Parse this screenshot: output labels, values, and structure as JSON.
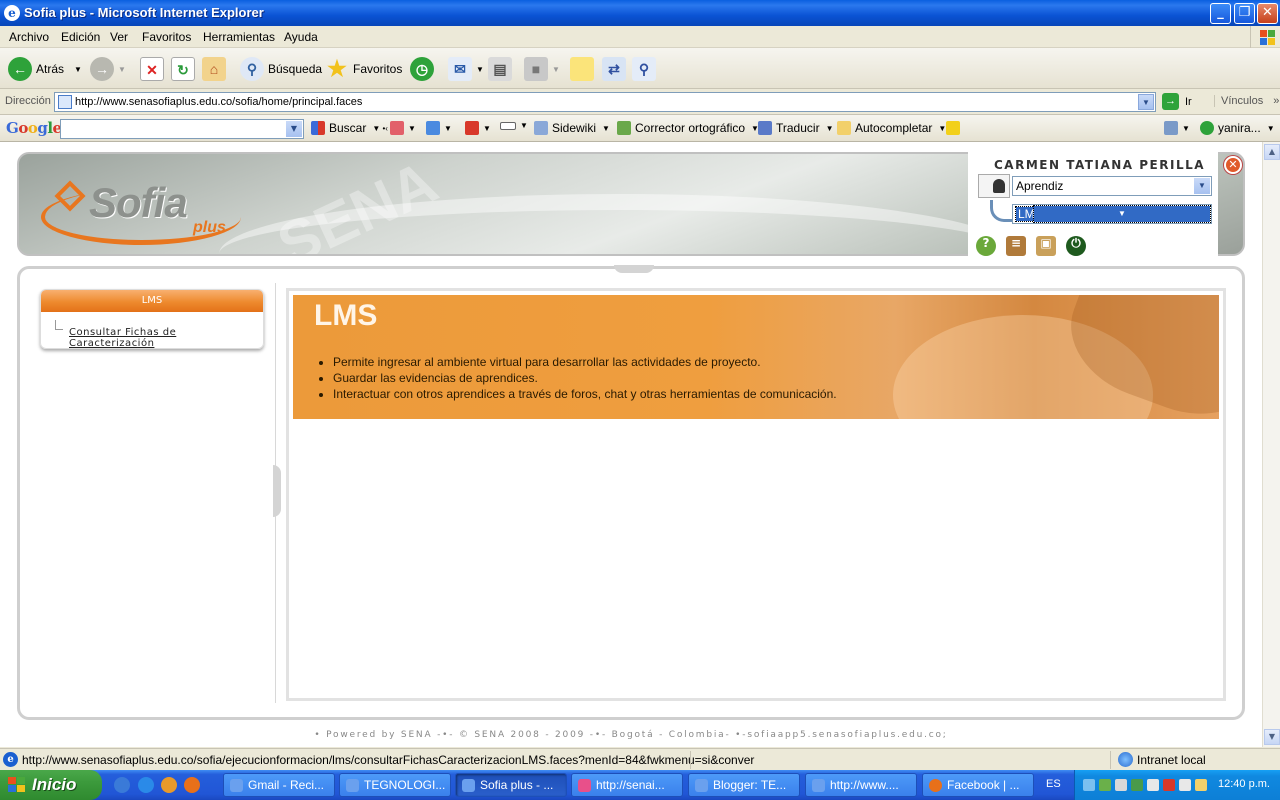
{
  "window": {
    "title": "Sofia plus - Microsoft Internet Explorer"
  },
  "menu": {
    "items": [
      "Archivo",
      "Edición",
      "Ver",
      "Favoritos",
      "Herramientas",
      "Ayuda"
    ]
  },
  "toolbar": {
    "back": "Atrás",
    "search": "Búsqueda",
    "favorites": "Favoritos"
  },
  "address": {
    "label": "Dirección",
    "url": "http://www.senasofiaplus.edu.co/sofia/home/principal.faces",
    "go": "Ir",
    "links": "Vínculos"
  },
  "google_bar": {
    "logo": "Google",
    "search": "Buscar",
    "sidewiki": "Sidewiki",
    "spell": "Corrector ortográfico",
    "translate": "Traducir",
    "autofill": "Autocompletar",
    "user": "yanira..."
  },
  "header": {
    "logo_word": "Sofia",
    "logo_sub": "plus",
    "watermark": "SENA",
    "user_name": "CARMEN TATIANA PERILLA",
    "role": "Aprendiz",
    "module": "LMS"
  },
  "sidebar": {
    "title": "LMS",
    "link": "Consultar Fichas de Caracterización"
  },
  "banner": {
    "title": "LMS",
    "bullets": [
      "Permite ingresar al ambiente virtual para desarrollar las actividades de proyecto.",
      "Guardar las evidencias de aprendices.",
      "Interactuar con otros aprendices a través de foros, chat y otras herramientas de comunicación."
    ]
  },
  "footer": {
    "text": "• Powered by SENA -•- © SENA 2008 - 2009 -•- Bogotá - Colombia- •-sofiaapp5.senasofiaplus.edu.co;"
  },
  "status": {
    "text": "http://www.senasofiaplus.edu.co/sofia/ejecucionformacion/lms/consultarFichasCaracterizacionLMS.faces?menId=84&fwkmenu=si&conver",
    "zone": "Intranet local"
  },
  "taskbar": {
    "start": "Inicio",
    "tasks": [
      "Gmail - Reci...",
      "TEGNOLOGI...",
      "Sofia plus - ...",
      "http://senai...",
      "Blogger: TE...",
      "http://www....",
      "Facebook | ..."
    ],
    "lang": "ES",
    "clock": "12:40 p.m."
  },
  "colors": {
    "accent": "#ee8a2e",
    "title_bar": "#0a53d4",
    "taskbar": "#245edb"
  }
}
